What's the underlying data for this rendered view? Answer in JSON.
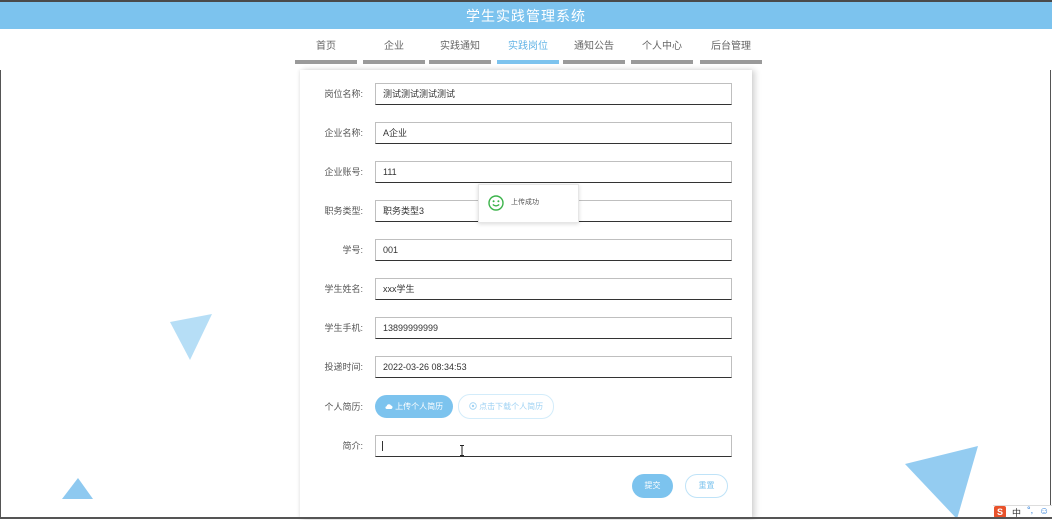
{
  "app": {
    "title": "学生实践管理系统"
  },
  "nav": {
    "items": [
      {
        "label": "首页"
      },
      {
        "label": "企业"
      },
      {
        "label": "实践通知"
      },
      {
        "label": "实践岗位"
      },
      {
        "label": "通知公告"
      },
      {
        "label": "个人中心"
      },
      {
        "label": "后台管理"
      }
    ],
    "active_index": 3
  },
  "form": {
    "fields": [
      {
        "label": "岗位名称:",
        "value": "测试测试测试测试"
      },
      {
        "label": "企业名称:",
        "value": "A企业"
      },
      {
        "label": "企业账号:",
        "value": "111"
      },
      {
        "label": "职务类型:",
        "value": "职务类型3"
      },
      {
        "label": "学号:",
        "value": "001"
      },
      {
        "label": "学生姓名:",
        "value": "xxx学生"
      },
      {
        "label": "学生手机:",
        "value": "13899999999"
      },
      {
        "label": "投递时间:",
        "value": "2022-03-26 08:34:53"
      }
    ],
    "resume_label": "个人简历:",
    "upload_label": "上传个人简历",
    "download_label": "点击下载个人简历",
    "intro_label": "简介:",
    "intro_value": "",
    "submit_label": "提交",
    "reset_label": "重置"
  },
  "toast": {
    "message": "上传成功",
    "icon": "smile-icon"
  },
  "tray": {
    "ime_logo": "S",
    "ime_mode": "中",
    "punct": "°,",
    "emoji": "☺"
  },
  "colors": {
    "accent": "#7cc3ee",
    "deco": "#8ec9f0",
    "toast_icon": "#3bb34a"
  }
}
